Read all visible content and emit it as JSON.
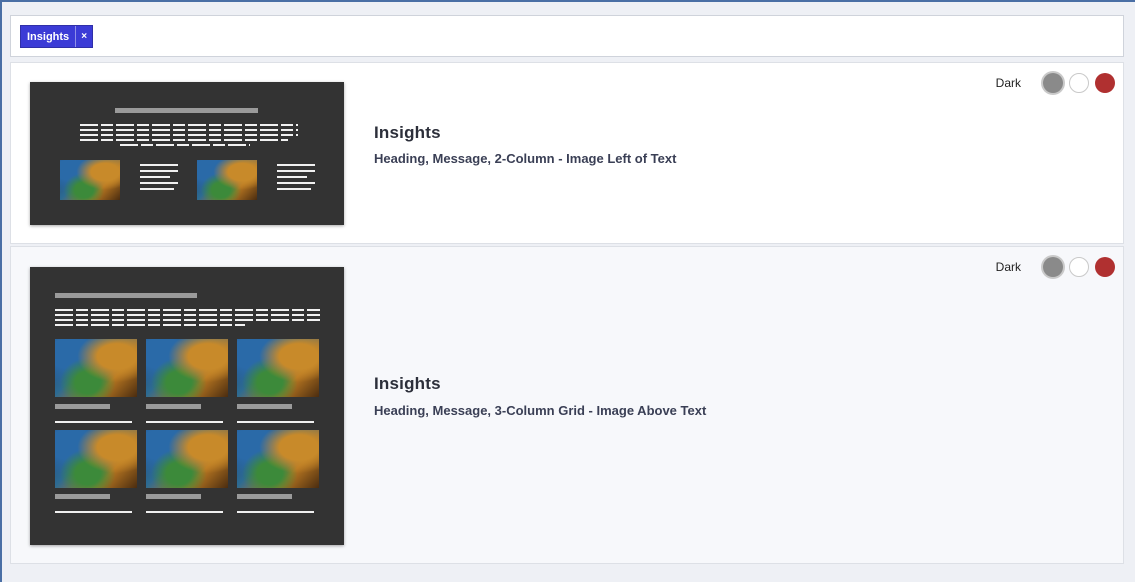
{
  "filter": {
    "tags": [
      {
        "label": "Insights",
        "remove": "×"
      }
    ]
  },
  "templates": [
    {
      "title": "Insights",
      "subtitle": "Heading, Message, 2-Column - Image Left of Text",
      "theme_label": "Dark",
      "swatches": [
        "#8a8a8a",
        "#ffffff",
        "#b03030"
      ],
      "selected_swatch": 0
    },
    {
      "title": "Insights",
      "subtitle": "Heading, Message, 3-Column Grid - Image Above Text",
      "theme_label": "Dark",
      "swatches": [
        "#8a8a8a",
        "#ffffff",
        "#b03030"
      ],
      "selected_swatch": 0
    }
  ]
}
